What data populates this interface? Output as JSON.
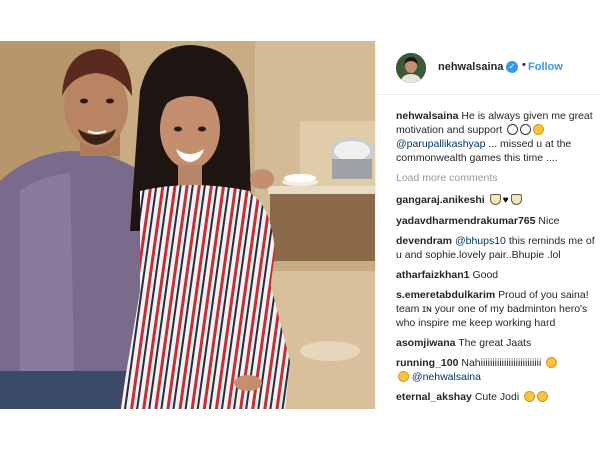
{
  "post": {
    "username": "nehwalsaina",
    "verified_badge": "✓",
    "separator": "•",
    "follow_label": "Follow",
    "caption": {
      "username": "nehwalsaina",
      "line1": "He is always given me great",
      "line2": "motivation and support",
      "mention": "@parupallikashyap",
      "line3": "... missed u at the",
      "line4": "commonwealth games this time ...."
    },
    "load_more_label": "Load more comments",
    "comments": [
      {
        "user": "gangaraj.anikeshi",
        "text": ""
      },
      {
        "user": "yadavdharmendrakumar765",
        "text": "Nice"
      },
      {
        "user": "devendram",
        "mention": "@bhups10",
        "text": "this reminds me of",
        "text2": "u and sophie.lovely pair..Bhupie .lol"
      },
      {
        "user": "atharfaizkhan1",
        "text": "Good"
      },
      {
        "user": "s.emeretabdulkarim",
        "text": "Proud of you saina! ",
        "text2": "team ɪɴ your one of my badminton hero's",
        "text3": "who inspire me keep working hard"
      },
      {
        "user": "asomjiwana",
        "text": "The great Jaats"
      },
      {
        "user": "running_100",
        "text": "Nahiiiiiiiiiiiiiiiiiiiiiiiiii",
        "mention2": "@nehwalsaina"
      },
      {
        "user": "eternal_akshay",
        "text": "Cute Jodi"
      }
    ]
  },
  "colors": {
    "link": "#3897f0",
    "mention": "#003569",
    "muted": "#999999",
    "text": "#262626"
  },
  "icons": [
    "verified-badge-icon",
    "smile-emoji-icon",
    "shuttlecock-emoji-icon",
    "heart-emoji-icon",
    "crying-emoji-icon"
  ]
}
